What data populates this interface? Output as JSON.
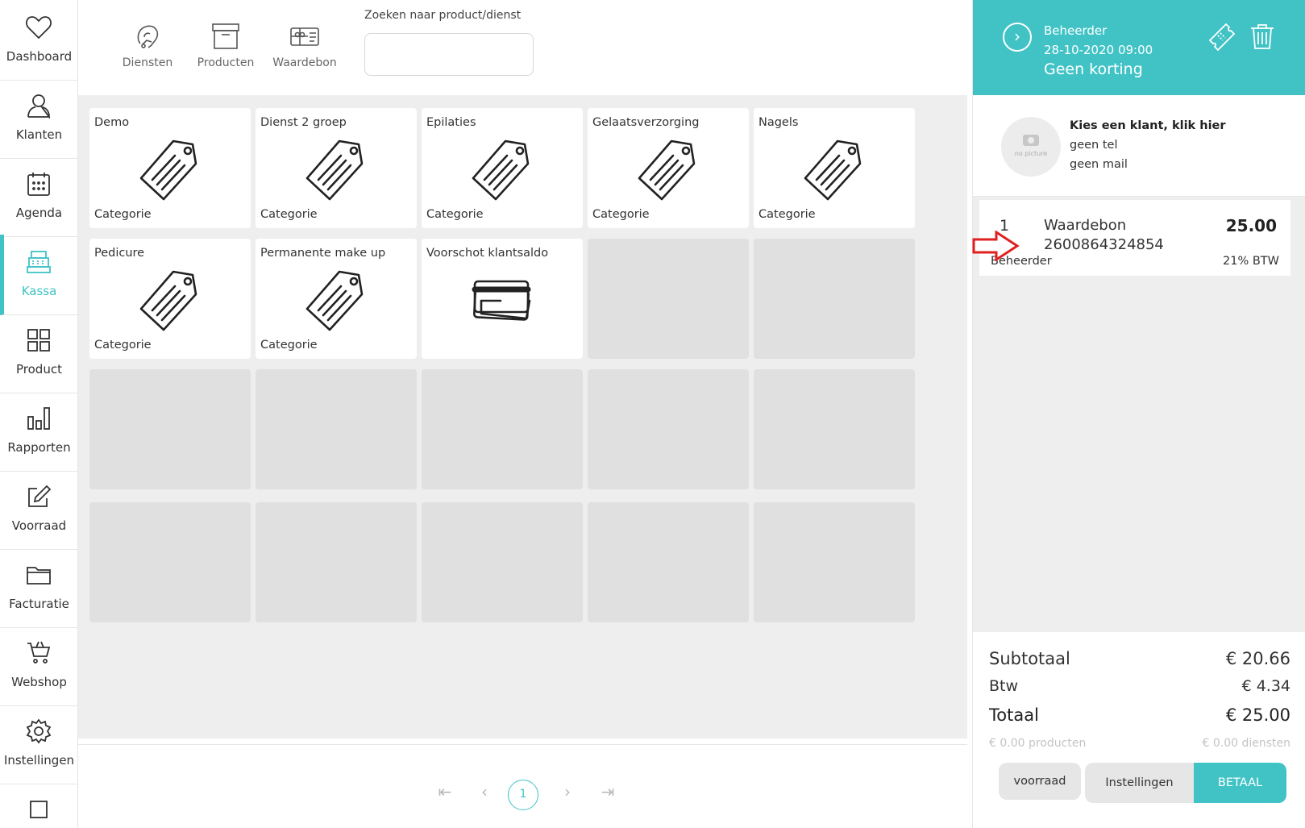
{
  "sidebar": {
    "items": [
      {
        "label": "Dashboard",
        "icon": "heart-icon"
      },
      {
        "label": "Klanten",
        "icon": "user-icon"
      },
      {
        "label": "Agenda",
        "icon": "calendar-icon"
      },
      {
        "label": "Kassa",
        "icon": "cash-register-icon",
        "active": true
      },
      {
        "label": "Product",
        "icon": "grid-icon"
      },
      {
        "label": "Rapporten",
        "icon": "bar-chart-icon"
      },
      {
        "label": "Voorraad",
        "icon": "edit-icon"
      },
      {
        "label": "Facturatie",
        "icon": "folder-icon"
      },
      {
        "label": "Webshop",
        "icon": "cart-icon"
      },
      {
        "label": "Instellingen",
        "icon": "gear-icon"
      }
    ]
  },
  "topbar": {
    "tabs": [
      {
        "label": "Diensten",
        "icon": "hair-service-icon"
      },
      {
        "label": "Producten",
        "icon": "box-icon"
      },
      {
        "label": "Waardebon",
        "icon": "gift-card-icon"
      }
    ],
    "search_label": "Zoeken naar product/dienst",
    "search_value": ""
  },
  "tiles": [
    {
      "name": "Demo",
      "category": "Categorie",
      "icon": "price-tag-icon"
    },
    {
      "name": "Dienst 2 groep",
      "category": "Categorie",
      "icon": "price-tag-icon"
    },
    {
      "name": "Epilaties",
      "category": "Categorie",
      "icon": "price-tag-icon"
    },
    {
      "name": "Gelaatsverzorging",
      "category": "Categorie",
      "icon": "price-tag-icon"
    },
    {
      "name": "Nagels",
      "category": "Categorie",
      "icon": "price-tag-icon"
    },
    {
      "name": "Pedicure",
      "category": "Categorie",
      "icon": "price-tag-icon"
    },
    {
      "name": "Permanente make up",
      "category": "Categorie",
      "icon": "price-tag-icon"
    },
    {
      "name": "Voorschot klantsaldo",
      "category": "",
      "icon": "credit-card-icon"
    }
  ],
  "pager": {
    "current": "1"
  },
  "register": {
    "header": {
      "user": "Beheerder",
      "datetime": "28-10-2020 09:00",
      "discount": "Geen korting"
    },
    "client": {
      "title": "Kies een klant, klik hier",
      "tel": "geen tel",
      "mail": "geen mail",
      "avatar_text": "no picture"
    },
    "lines": [
      {
        "qty": "1",
        "name": "Waardebon",
        "code": "2600864324854",
        "price": "25.00",
        "user": "Beheerder",
        "vat": "21% BTW"
      }
    ],
    "totals": {
      "subtotal_label": "Subtotaal",
      "subtotal": "€ 20.66",
      "btw_label": "Btw",
      "btw": "€ 4.34",
      "total_label": "Totaal",
      "total": "€ 25.00",
      "products": "€ 0.00 producten",
      "services": "€ 0.00 diensten"
    },
    "buttons": {
      "voorraad": "voorraad",
      "settings": "Instellingen",
      "pay": "BETAAL"
    }
  },
  "colors": {
    "accent": "#41c3c5",
    "annotation_arrow": "#e02020"
  }
}
